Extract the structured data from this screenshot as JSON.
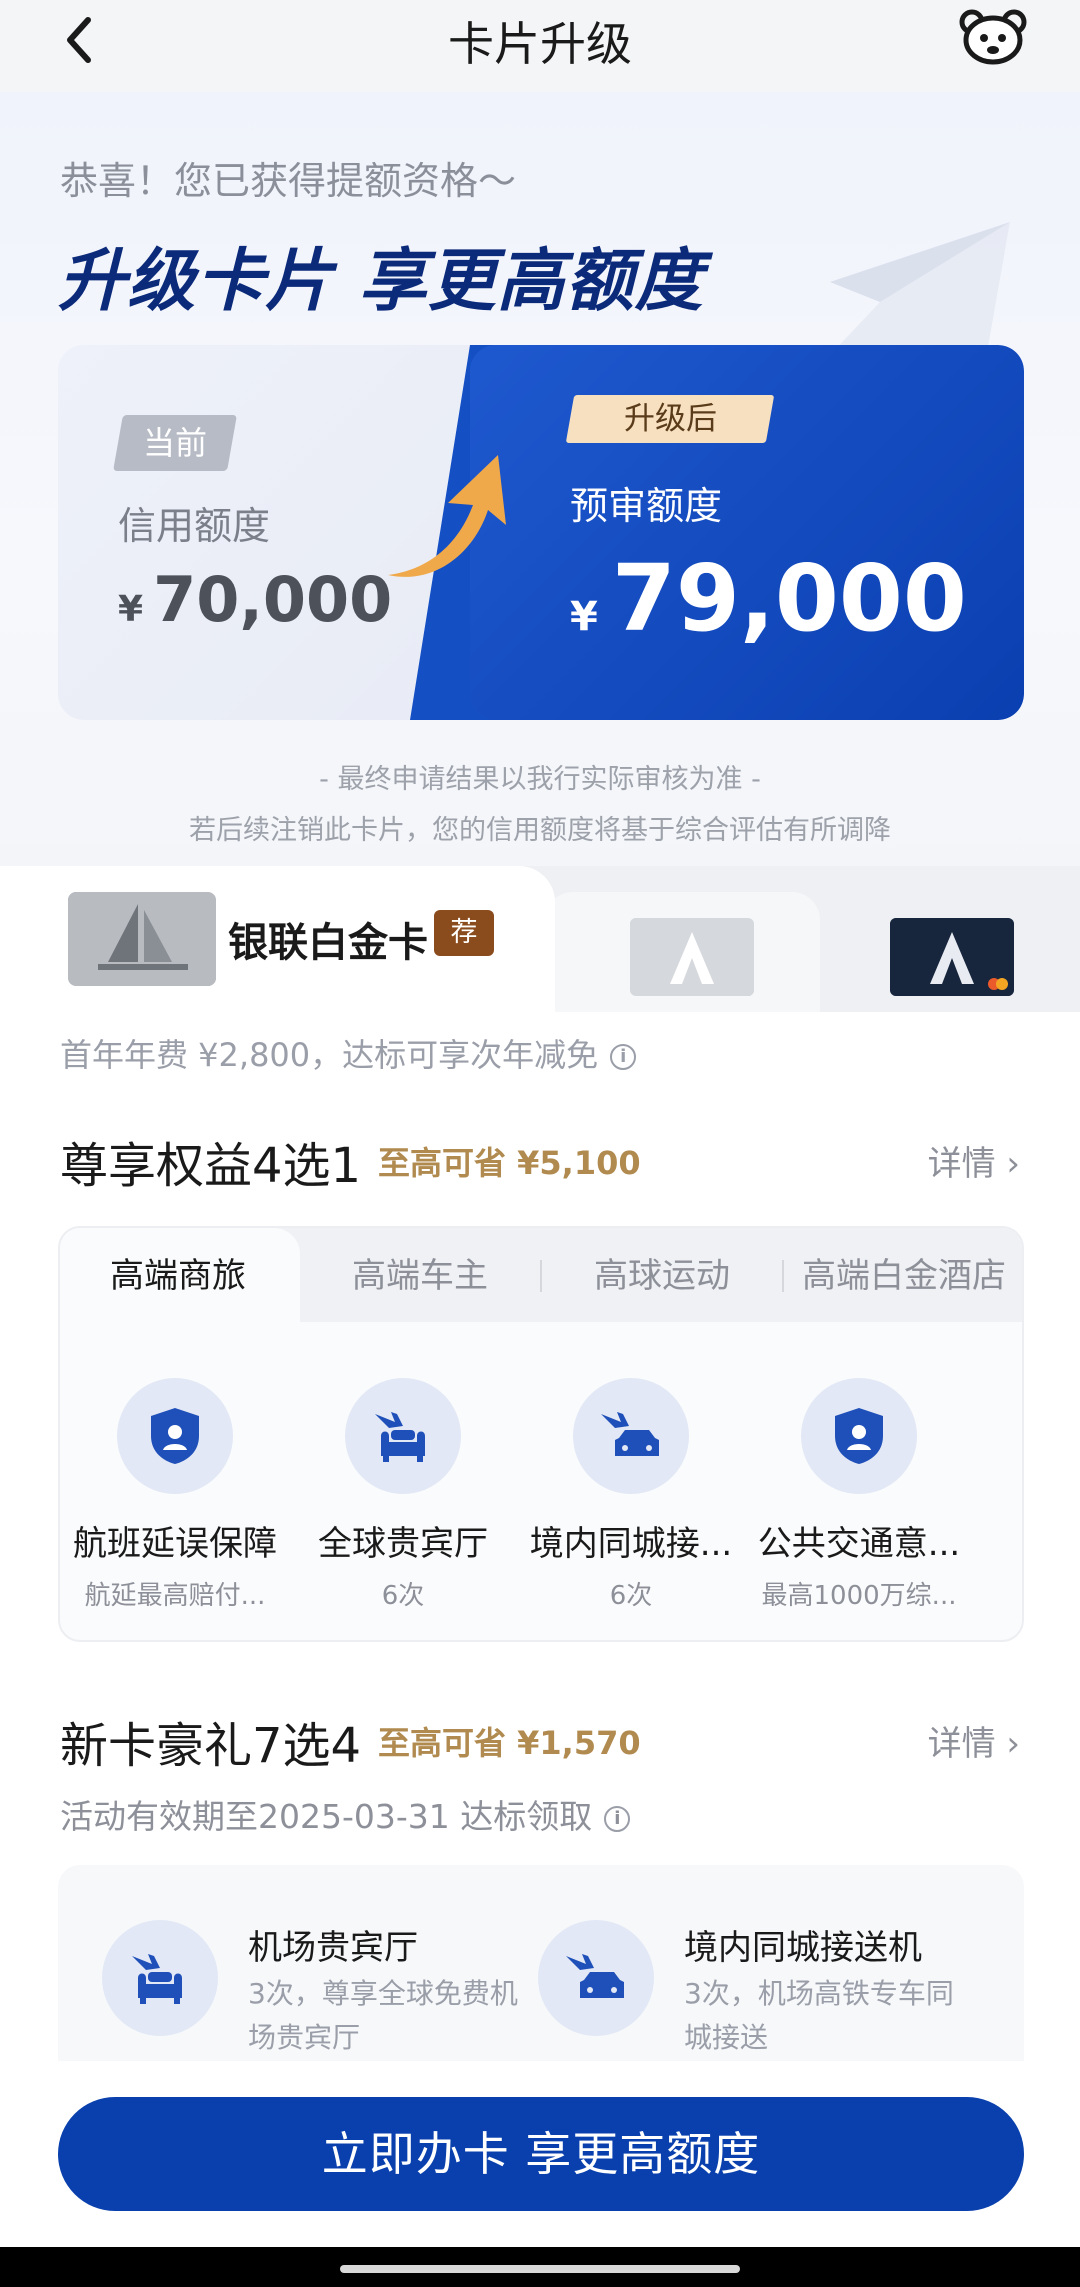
{
  "header": {
    "title": "卡片升级",
    "back_icon": "chevron-left-icon",
    "service_icon": "bear-service-icon"
  },
  "hero": {
    "congrats": "恭喜！您已获得提额资格～",
    "headline": "升级卡片 享更高额度",
    "current": {
      "badge": "当前",
      "label": "信用额度",
      "currency": "¥",
      "amount": "70,000"
    },
    "upgraded": {
      "badge": "升级后",
      "label": "预审额度",
      "currency": "¥",
      "amount": "79,000"
    },
    "note1": "- 最终申请结果以我行实际审核为准 -",
    "note2": "若后续注销此卡片，您的信用额度将基于综合评估有所调降"
  },
  "cards": {
    "selected_name": "银联白金卡",
    "recommend_badge": "荐"
  },
  "fee_text": "首年年费 ¥2,800，达标可享次年减免",
  "benefits": {
    "title": "尊享权益4选1",
    "save": "至高可省 ¥5,100",
    "detail": "详情",
    "tabs": [
      "高端商旅",
      "高端车主",
      "高球运动",
      "高端白金酒店"
    ],
    "items": [
      {
        "name": "航班延误保障",
        "sub": "航延最高赔付...",
        "icon": "shield-person-icon"
      },
      {
        "name": "全球贵宾厅",
        "sub": "6次",
        "icon": "plane-sofa-icon"
      },
      {
        "name": "境内同城接...",
        "sub": "6次",
        "icon": "plane-car-icon"
      },
      {
        "name": "公共交通意...",
        "sub": "最高1000万综...",
        "icon": "shield-person-icon"
      }
    ]
  },
  "gifts": {
    "title": "新卡豪礼7选4",
    "save": "至高可省 ¥1,570",
    "detail": "详情",
    "validity": "活动有效期至2025-03-31  达标领取",
    "items": [
      {
        "name": "机场贵宾厅",
        "desc": "3次，尊享全球免费机场贵宾厅",
        "icon": "plane-sofa-icon"
      },
      {
        "name": "境内同城接送机",
        "desc": "3次，机场高铁专车同城接送",
        "icon": "plane-car-icon"
      }
    ]
  },
  "cta": "立即办卡 享更高额度",
  "colors": {
    "primary": "#0940ad",
    "gold": "#b08a4f",
    "badge_brown": "#8a4b1d"
  }
}
